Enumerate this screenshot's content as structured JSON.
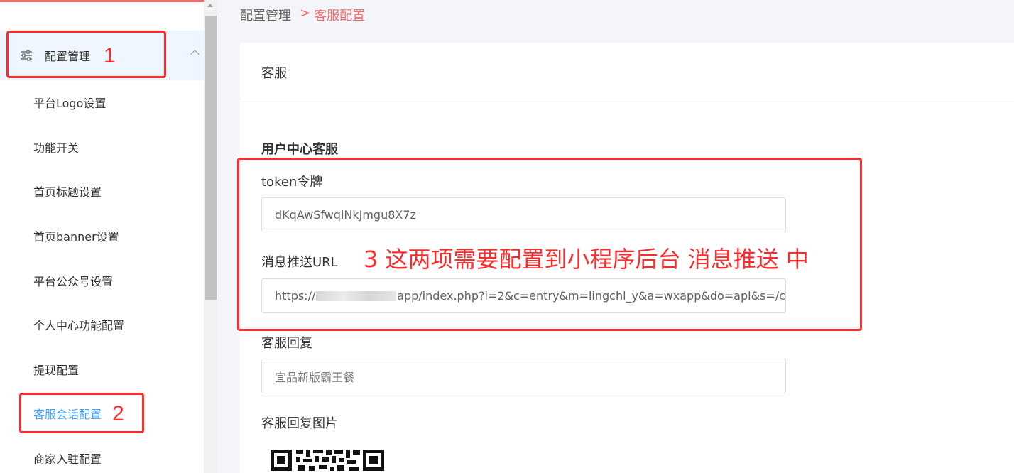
{
  "sidebar": {
    "group": {
      "label": "配置管理",
      "icon": "sliders-icon"
    },
    "items": [
      {
        "label": "平台Logo设置",
        "active": false
      },
      {
        "label": "功能开关",
        "active": false
      },
      {
        "label": "首页标题设置",
        "active": false
      },
      {
        "label": "首页banner设置",
        "active": false
      },
      {
        "label": "平台公众号设置",
        "active": false
      },
      {
        "label": "个人中心功能配置",
        "active": false
      },
      {
        "label": "提现配置",
        "active": false
      },
      {
        "label": "客服会话配置",
        "active": true
      },
      {
        "label": "商家入驻配置",
        "active": false
      }
    ]
  },
  "breadcrumb": {
    "parent": "配置管理",
    "separator": ">",
    "current": "客服配置"
  },
  "card": {
    "header": "客服",
    "section_title": "用户中心客服",
    "fields": {
      "token": {
        "label": "token令牌",
        "value": "dKqAwSfwqlNkJmgu8X7z"
      },
      "url": {
        "label": "消息推送URL",
        "value_prefix": "https://",
        "value_suffix": "app/index.php?i=2&c=entry&m=lingchi_y&a=wxapp&do=api&s=/c"
      },
      "reply": {
        "label": "客服回复",
        "value": "宜品新版霸王餐"
      },
      "reply_image": {
        "label": "客服回复图片"
      }
    }
  },
  "annotations": {
    "n1": "1",
    "n2": "2",
    "n3_text": "3 这两项需要配置到小程序后台 消息推送 中"
  },
  "colors": {
    "accent_red": "#f56c6c",
    "annotation_red": "#ff2a2a",
    "active_blue": "#409eff"
  }
}
